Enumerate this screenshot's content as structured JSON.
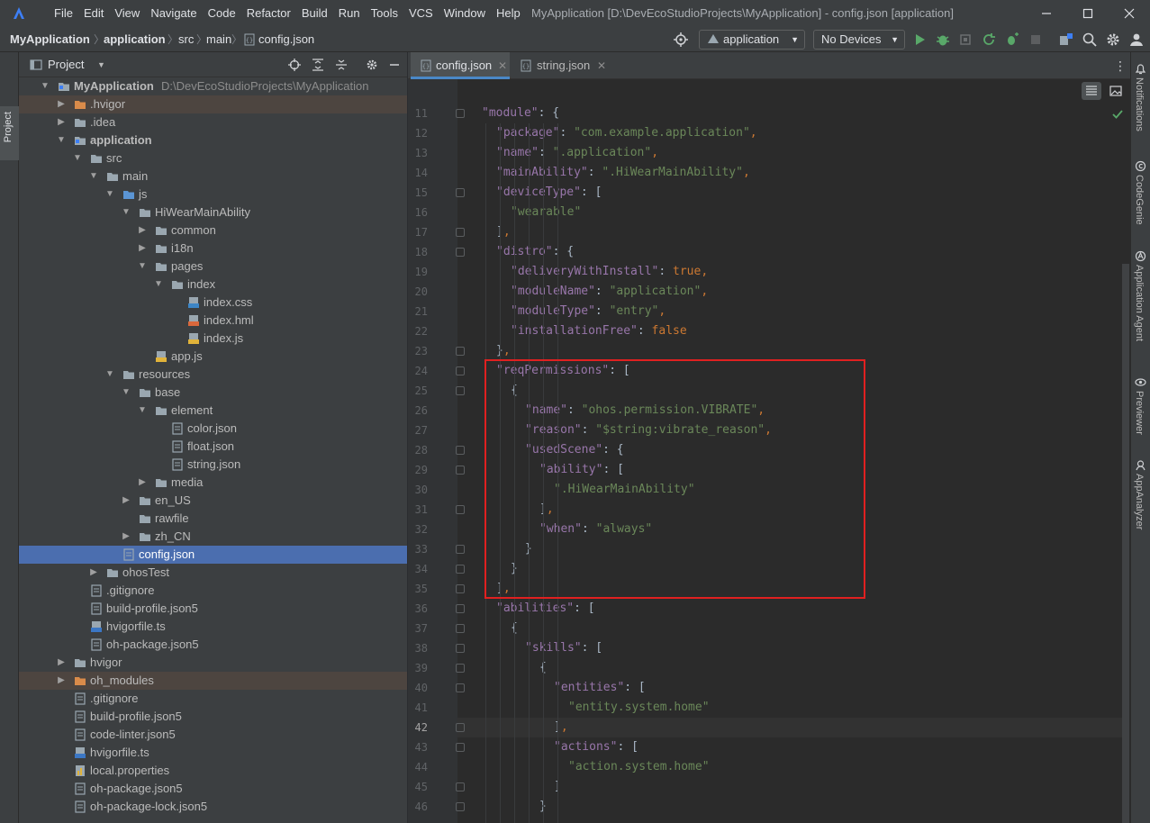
{
  "menu": [
    "File",
    "Edit",
    "View",
    "Navigate",
    "Code",
    "Refactor",
    "Build",
    "Run",
    "Tools",
    "VCS",
    "Window",
    "Help"
  ],
  "window_title": "MyApplication [D:\\DevEcoStudioProjects\\MyApplication] - config.json [application]",
  "breadcrumbs": [
    "MyApplication",
    "application",
    "src",
    "main",
    "config.json"
  ],
  "run_config": "application",
  "device": "No Devices",
  "project_panel": {
    "title": "Project",
    "left_tab": "Project",
    "rows": [
      {
        "label": "MyApplication",
        "hint": "D:\\DevEcoStudioProjects\\MyApplication",
        "indent": 0,
        "chev": "down",
        "icon": "module",
        "bold": true
      },
      {
        "label": ".hvigor",
        "indent": 1,
        "chev": "right",
        "icon": "folder-orange",
        "excl": true
      },
      {
        "label": ".idea",
        "indent": 1,
        "chev": "right",
        "icon": "folder"
      },
      {
        "label": "application",
        "indent": 1,
        "chev": "down",
        "icon": "module",
        "bold": true
      },
      {
        "label": "src",
        "indent": 2,
        "chev": "down",
        "icon": "folder"
      },
      {
        "label": "main",
        "indent": 3,
        "chev": "down",
        "icon": "folder"
      },
      {
        "label": "js",
        "indent": 4,
        "chev": "down",
        "icon": "folder-blue"
      },
      {
        "label": "HiWearMainAbility",
        "indent": 5,
        "chev": "down",
        "icon": "folder"
      },
      {
        "label": "common",
        "indent": 6,
        "chev": "right",
        "icon": "folder"
      },
      {
        "label": "i18n",
        "indent": 6,
        "chev": "right",
        "icon": "folder"
      },
      {
        "label": "pages",
        "indent": 6,
        "chev": "down",
        "icon": "folder"
      },
      {
        "label": "index",
        "indent": 7,
        "chev": "down",
        "icon": "folder"
      },
      {
        "label": "index.css",
        "indent": 8,
        "chev": "",
        "icon": "file-css"
      },
      {
        "label": "index.hml",
        "indent": 8,
        "chev": "",
        "icon": "file-hml"
      },
      {
        "label": "index.js",
        "indent": 8,
        "chev": "",
        "icon": "file-js"
      },
      {
        "label": "app.js",
        "indent": 6,
        "chev": "",
        "icon": "file-js"
      },
      {
        "label": "resources",
        "indent": 4,
        "chev": "down",
        "icon": "folder"
      },
      {
        "label": "base",
        "indent": 5,
        "chev": "down",
        "icon": "folder"
      },
      {
        "label": "element",
        "indent": 6,
        "chev": "down",
        "icon": "folder"
      },
      {
        "label": "color.json",
        "indent": 7,
        "chev": "",
        "icon": "file-json"
      },
      {
        "label": "float.json",
        "indent": 7,
        "chev": "",
        "icon": "file-json"
      },
      {
        "label": "string.json",
        "indent": 7,
        "chev": "",
        "icon": "file-json"
      },
      {
        "label": "media",
        "indent": 6,
        "chev": "right",
        "icon": "folder"
      },
      {
        "label": "en_US",
        "indent": 5,
        "chev": "right",
        "icon": "folder"
      },
      {
        "label": "rawfile",
        "indent": 5,
        "chev": "",
        "icon": "folder"
      },
      {
        "label": "zh_CN",
        "indent": 5,
        "chev": "right",
        "icon": "folder"
      },
      {
        "label": "config.json",
        "indent": 4,
        "chev": "",
        "icon": "file-json",
        "selected": true
      },
      {
        "label": "ohosTest",
        "indent": 3,
        "chev": "right",
        "icon": "folder"
      },
      {
        "label": ".gitignore",
        "indent": 2,
        "chev": "",
        "icon": "file-json"
      },
      {
        "label": "build-profile.json5",
        "indent": 2,
        "chev": "",
        "icon": "file-json"
      },
      {
        "label": "hvigorfile.ts",
        "indent": 2,
        "chev": "",
        "icon": "file-ts"
      },
      {
        "label": "oh-package.json5",
        "indent": 2,
        "chev": "",
        "icon": "file-json"
      },
      {
        "label": "hvigor",
        "indent": 1,
        "chev": "right",
        "icon": "folder"
      },
      {
        "label": "oh_modules",
        "indent": 1,
        "chev": "right",
        "icon": "folder-orange",
        "excl": true
      },
      {
        "label": ".gitignore",
        "indent": 1,
        "chev": "",
        "icon": "file-json"
      },
      {
        "label": "build-profile.json5",
        "indent": 1,
        "chev": "",
        "icon": "file-json"
      },
      {
        "label": "code-linter.json5",
        "indent": 1,
        "chev": "",
        "icon": "file-json"
      },
      {
        "label": "hvigorfile.ts",
        "indent": 1,
        "chev": "",
        "icon": "file-ts"
      },
      {
        "label": "local.properties",
        "indent": 1,
        "chev": "",
        "icon": "file-props"
      },
      {
        "label": "oh-package.json5",
        "indent": 1,
        "chev": "",
        "icon": "file-json"
      },
      {
        "label": "oh-package-lock.json5",
        "indent": 1,
        "chev": "",
        "icon": "file-json"
      }
    ]
  },
  "tabs": [
    {
      "label": "config.json",
      "active": true
    },
    {
      "label": "string.json",
      "active": false
    }
  ],
  "code_lines": [
    {
      "n": 11,
      "indent": 0,
      "tokens": [
        [
          "k",
          "\"module\""
        ],
        [
          "p",
          ": {"
        ]
      ]
    },
    {
      "n": 12,
      "indent": 1,
      "tokens": [
        [
          "k",
          "\"package\""
        ],
        [
          "p",
          ": "
        ],
        [
          "s",
          "\"com.example.application\""
        ],
        [
          "b",
          ","
        ]
      ]
    },
    {
      "n": 13,
      "indent": 1,
      "tokens": [
        [
          "k",
          "\"name\""
        ],
        [
          "p",
          ": "
        ],
        [
          "s",
          "\".application\""
        ],
        [
          "b",
          ","
        ]
      ]
    },
    {
      "n": 14,
      "indent": 1,
      "tokens": [
        [
          "k",
          "\"mainAbility\""
        ],
        [
          "p",
          ": "
        ],
        [
          "s",
          "\".HiWearMainAbility\""
        ],
        [
          "b",
          ","
        ]
      ]
    },
    {
      "n": 15,
      "indent": 1,
      "tokens": [
        [
          "k",
          "\"deviceType\""
        ],
        [
          "p",
          ": ["
        ]
      ]
    },
    {
      "n": 16,
      "indent": 2,
      "tokens": [
        [
          "s",
          "\"wearable\""
        ]
      ]
    },
    {
      "n": 17,
      "indent": 1,
      "tokens": [
        [
          "p",
          "]"
        ],
        [
          "b",
          ","
        ]
      ]
    },
    {
      "n": 18,
      "indent": 1,
      "tokens": [
        [
          "k",
          "\"distro\""
        ],
        [
          "p",
          ": {"
        ]
      ]
    },
    {
      "n": 19,
      "indent": 2,
      "tokens": [
        [
          "k",
          "\"deliveryWithInstall\""
        ],
        [
          "p",
          ": "
        ],
        [
          "b",
          "true,"
        ]
      ]
    },
    {
      "n": 20,
      "indent": 2,
      "tokens": [
        [
          "k",
          "\"moduleName\""
        ],
        [
          "p",
          ": "
        ],
        [
          "s",
          "\"application\""
        ],
        [
          "b",
          ","
        ]
      ]
    },
    {
      "n": 21,
      "indent": 2,
      "tokens": [
        [
          "k",
          "\"moduleType\""
        ],
        [
          "p",
          ": "
        ],
        [
          "s",
          "\"entry\""
        ],
        [
          "b",
          ","
        ]
      ]
    },
    {
      "n": 22,
      "indent": 2,
      "tokens": [
        [
          "k",
          "\"installationFree\""
        ],
        [
          "p",
          ": "
        ],
        [
          "b",
          "false"
        ]
      ]
    },
    {
      "n": 23,
      "indent": 1,
      "tokens": [
        [
          "p",
          "}"
        ],
        [
          "b",
          ","
        ]
      ]
    },
    {
      "n": 24,
      "indent": 1,
      "tokens": [
        [
          "k",
          "\"reqPermissions\""
        ],
        [
          "p",
          ": ["
        ]
      ]
    },
    {
      "n": 25,
      "indent": 2,
      "tokens": [
        [
          "p",
          "{"
        ]
      ]
    },
    {
      "n": 26,
      "indent": 3,
      "tokens": [
        [
          "k",
          "\"name\""
        ],
        [
          "p",
          ": "
        ],
        [
          "s",
          "\"ohos.permission.VIBRATE\""
        ],
        [
          "b",
          ","
        ]
      ]
    },
    {
      "n": 27,
      "indent": 3,
      "tokens": [
        [
          "k",
          "\"reason\""
        ],
        [
          "p",
          ": "
        ],
        [
          "s",
          "\"$string:vibrate_reason\""
        ],
        [
          "b",
          ","
        ]
      ]
    },
    {
      "n": 28,
      "indent": 3,
      "tokens": [
        [
          "k",
          "\"usedScene\""
        ],
        [
          "p",
          ": {"
        ]
      ]
    },
    {
      "n": 29,
      "indent": 4,
      "tokens": [
        [
          "k",
          "\"ability\""
        ],
        [
          "p",
          ": ["
        ]
      ]
    },
    {
      "n": 30,
      "indent": 5,
      "tokens": [
        [
          "s",
          "\".HiWearMainAbility\""
        ]
      ]
    },
    {
      "n": 31,
      "indent": 4,
      "tokens": [
        [
          "p",
          "]"
        ],
        [
          "b",
          ","
        ]
      ]
    },
    {
      "n": 32,
      "indent": 4,
      "tokens": [
        [
          "k",
          "\"when\""
        ],
        [
          "p",
          ": "
        ],
        [
          "s",
          "\"always\""
        ]
      ]
    },
    {
      "n": 33,
      "indent": 3,
      "tokens": [
        [
          "p",
          "}"
        ]
      ]
    },
    {
      "n": 34,
      "indent": 2,
      "tokens": [
        [
          "p",
          "}"
        ]
      ]
    },
    {
      "n": 35,
      "indent": 1,
      "tokens": [
        [
          "p",
          "]"
        ],
        [
          "b",
          ","
        ]
      ]
    },
    {
      "n": 36,
      "indent": 1,
      "tokens": [
        [
          "k",
          "\"abilities\""
        ],
        [
          "p",
          ": ["
        ]
      ]
    },
    {
      "n": 37,
      "indent": 2,
      "tokens": [
        [
          "p",
          "{"
        ]
      ]
    },
    {
      "n": 38,
      "indent": 3,
      "tokens": [
        [
          "k",
          "\"skills\""
        ],
        [
          "p",
          ": ["
        ]
      ]
    },
    {
      "n": 39,
      "indent": 4,
      "tokens": [
        [
          "p",
          "{"
        ]
      ]
    },
    {
      "n": 40,
      "indent": 5,
      "tokens": [
        [
          "k",
          "\"entities\""
        ],
        [
          "p",
          ": ["
        ]
      ]
    },
    {
      "n": 41,
      "indent": 6,
      "tokens": [
        [
          "s",
          "\"entity.system.home\""
        ]
      ]
    },
    {
      "n": 42,
      "indent": 5,
      "tokens": [
        [
          "p",
          "]"
        ],
        [
          "b",
          ","
        ]
      ]
    },
    {
      "n": 43,
      "indent": 5,
      "tokens": [
        [
          "k",
          "\"actions\""
        ],
        [
          "p",
          ": ["
        ]
      ]
    },
    {
      "n": 44,
      "indent": 6,
      "tokens": [
        [
          "s",
          "\"action.system.home\""
        ]
      ]
    },
    {
      "n": 45,
      "indent": 5,
      "tokens": [
        [
          "p",
          "]"
        ]
      ]
    },
    {
      "n": 46,
      "indent": 4,
      "tokens": [
        [
          "p",
          "}"
        ]
      ]
    }
  ],
  "current_line": 42,
  "right_tools": [
    "Notifications",
    "CodeGenie",
    "Application Agent",
    "Previewer",
    "AppAnalyzer"
  ],
  "colors": {
    "accent": "#4a88c7",
    "selection": "#4b6eaf",
    "highlight_box": "#e02020"
  }
}
